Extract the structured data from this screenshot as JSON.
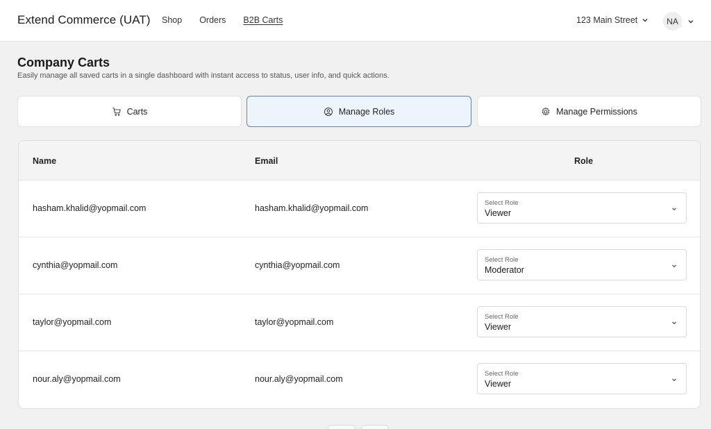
{
  "header": {
    "brand": "Extend Commerce (UAT)",
    "nav": [
      {
        "label": "Shop"
      },
      {
        "label": "Orders"
      },
      {
        "label": "B2B Carts"
      }
    ],
    "address": "123 Main Street",
    "avatar_initials": "NA"
  },
  "page": {
    "title": "Company Carts",
    "subtitle": "Easily manage all saved carts in a single dashboard with instant access to status, user info, and quick actions."
  },
  "tabs": [
    {
      "label": "Carts",
      "icon": "cart-icon",
      "active": false
    },
    {
      "label": "Manage Roles",
      "icon": "user-circle-icon",
      "active": true
    },
    {
      "label": "Manage Permissions",
      "icon": "gear-icon",
      "active": false
    }
  ],
  "table": {
    "columns": {
      "name": "Name",
      "email": "Email",
      "role": "Role"
    },
    "rows": [
      {
        "name": "hasham.khalid@yopmail.com",
        "email": "hasham.khalid@yopmail.com",
        "role_label": "Select Role",
        "role": "Viewer"
      },
      {
        "name": "cynthia@yopmail.com",
        "email": "cynthia@yopmail.com",
        "role_label": "Select Role",
        "role": "Moderator"
      },
      {
        "name": "taylor@yopmail.com",
        "email": "taylor@yopmail.com",
        "role_label": "Select Role",
        "role": "Viewer"
      },
      {
        "name": "nour.aly@yopmail.com",
        "email": "nour.aly@yopmail.com",
        "role_label": "Select Role",
        "role": "Viewer"
      }
    ]
  },
  "colors": {
    "active_tab_bg": "#eef4fc",
    "active_tab_border": "#5b86b8",
    "page_bg": "#f1f1f1"
  }
}
